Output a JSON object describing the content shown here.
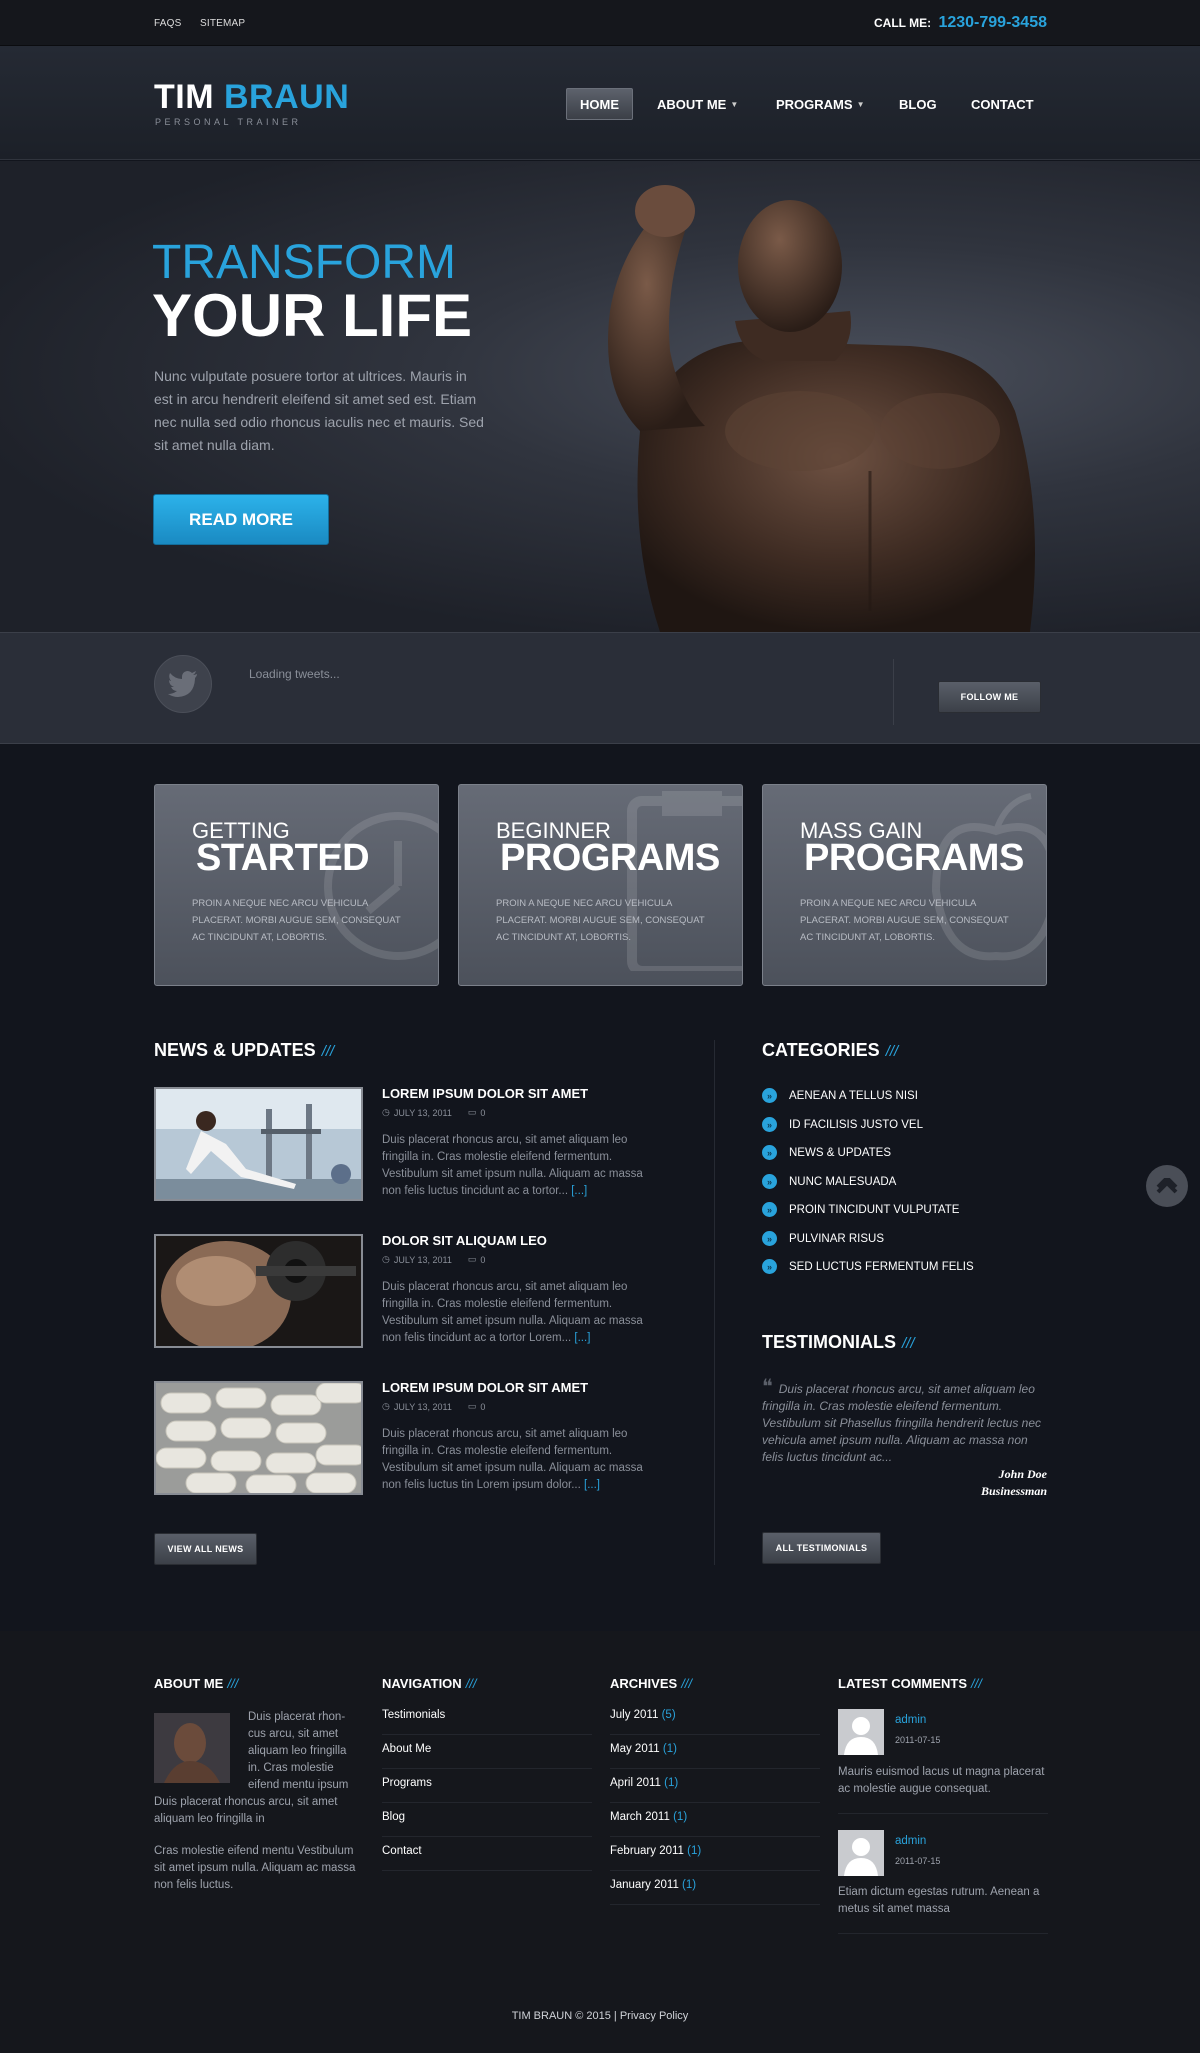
{
  "topbar": {
    "links": [
      "FAQS",
      "SITEMAP"
    ],
    "call_label": "CALL ME:",
    "phone": "1230-799-3458"
  },
  "header": {
    "logo_part1": "TIM",
    "logo_part2": "BRAUN",
    "tagline": "PERSONAL TRAINER",
    "nav": [
      {
        "label": "HOME",
        "active": true
      },
      {
        "label": "ABOUT ME",
        "dropdown": true
      },
      {
        "label": "PROGRAMS",
        "dropdown": true
      },
      {
        "label": "BLOG"
      },
      {
        "label": "CONTACT"
      }
    ]
  },
  "hero": {
    "title_line1": "TRANSFORM",
    "title_line2": "YOUR LIFE",
    "text": "Nunc vulputate posuere tortor at ultrices. Mauris in est in arcu hendrerit eleifend sit amet sed est. Etiam nec nulla sed odio rhoncus iaculis nec et mauris. Sed sit amet nulla diam.",
    "button": "READ MORE"
  },
  "tweets": {
    "status": "Loading tweets...",
    "follow_button": "FOLLOW ME"
  },
  "features": [
    {
      "small": "GETTING",
      "big": "STARTED",
      "desc": "PROIN A NEQUE NEC ARCU VEHICULA PLACERAT. MORBI AUGUE SEM, CONSEQUAT AC TINCIDUNT AT, LOBORTIS."
    },
    {
      "small": "BEGINNER",
      "big": "PROGRAMS",
      "desc": "PROIN A NEQUE NEC ARCU VEHICULA PLACERAT. MORBI AUGUE SEM, CONSEQUAT AC TINCIDUNT AT, LOBORTIS."
    },
    {
      "small": "MASS GAIN",
      "big": "PROGRAMS",
      "desc": "PROIN A NEQUE NEC ARCU VEHICULA PLACERAT. MORBI AUGUE SEM, CONSEQUAT AC TINCIDUNT AT, LOBORTIS."
    }
  ],
  "news": {
    "title": "NEWS & UPDATES",
    "slashes": "///",
    "items": [
      {
        "title": "LOREM IPSUM DOLOR SIT AMET",
        "date": "JULY 13, 2011",
        "comments": "0",
        "text": "Duis placerat rhoncus arcu, sit amet aliquam leo fringilla in. Cras molestie eleifend fermentum. Vestibulum sit amet ipsum nulla.  Aliquam ac massa non felis luctus tincidunt ac a tortor...",
        "more": "[...]"
      },
      {
        "title": "DOLOR SIT ALIQUAM LEO",
        "date": "JULY 13, 2011",
        "comments": "0",
        "text": "Duis placerat rhoncus arcu, sit amet aliquam leo fringilla in. Cras molestie eleifend fermentum. Vestibulum sit amet ipsum nulla.  Aliquam ac massa non felis tincidunt ac a tortor Lorem...",
        "more": "[...]"
      },
      {
        "title": "LOREM IPSUM DOLOR SIT AMET",
        "date": "JULY 13, 2011",
        "comments": "0",
        "text": "Duis placerat rhoncus arcu, sit amet aliquam leo fringilla in. Cras molestie eleifend fermentum. Vestibulum sit amet ipsum nulla.  Aliquam ac massa non felis luctus tin Lorem ipsum dolor...",
        "more": "[...]"
      }
    ],
    "view_all": "VIEW ALL NEWS"
  },
  "categories": {
    "title": "CATEGORIES",
    "slashes": "///",
    "items": [
      "AENEAN A TELLUS NISI",
      "ID FACILISIS JUSTO VEL",
      "NEWS & UPDATES",
      "NUNC MALESUADA",
      "PROIN TINCIDUNT VULPUTATE",
      "PULVINAR RISUS",
      "SED LUCTUS FERMENTUM FELIS"
    ]
  },
  "testimonials": {
    "title": "TESTIMONIALS",
    "slashes": "///",
    "quote": "Duis placerat rhoncus arcu, sit amet aliquam leo fringilla in. Cras molestie eleifend fermentum. Vestibulum sit Phasellus fringilla hendrerit lectus nec vehicula amet ipsum nulla. Aliquam ac massa non felis luctus tincidunt ac...",
    "name": "John Doe",
    "role": "Businessman",
    "button": "ALL TESTIMONIALS"
  },
  "footer": {
    "about": {
      "title": "ABOUT ME",
      "text_beside": "Duis placerat rhon-cus arcu, sit amet aliquam leo fringilla in. Cras molestie eifend mentu ipsum",
      "text_below": "Duis placerat rhoncus arcu, sit amet aliquam leo fringilla in",
      "text2": "Cras molestie eifend mentu Vestibulum sit amet ipsum nulla. Aliquam ac massa non felis luctus."
    },
    "navigation": {
      "title": "NAVIGATION",
      "links": [
        "Testimonials",
        "About Me",
        "Programs",
        "Blog",
        "Contact"
      ]
    },
    "archives": {
      "title": "ARCHIVES",
      "items": [
        {
          "month": "July 2011",
          "count": "(5)"
        },
        {
          "month": "May 2011",
          "count": "(1)"
        },
        {
          "month": "April 2011",
          "count": "(1)"
        },
        {
          "month": "March 2011",
          "count": "(1)"
        },
        {
          "month": "February 2011",
          "count": "(1)"
        },
        {
          "month": "January 2011",
          "count": "(1)"
        }
      ]
    },
    "comments": {
      "title": "LATEST COMMENTS",
      "items": [
        {
          "author": "admin",
          "date": "2011-07-15",
          "text": "Mauris euismod lacus ut magna placerat ac molestie augue consequat."
        },
        {
          "author": "admin",
          "date": "2011-07-15",
          "text": "Etiam dictum egestas rutrum. Aenean a metus sit amet massa"
        }
      ]
    },
    "slashes": "///",
    "copyright": "TIM BRAUN © 2015 | Privacy Policy"
  },
  "colors": {
    "accent": "#29a3dc",
    "background": "#12151d",
    "footer": "#15171c"
  }
}
